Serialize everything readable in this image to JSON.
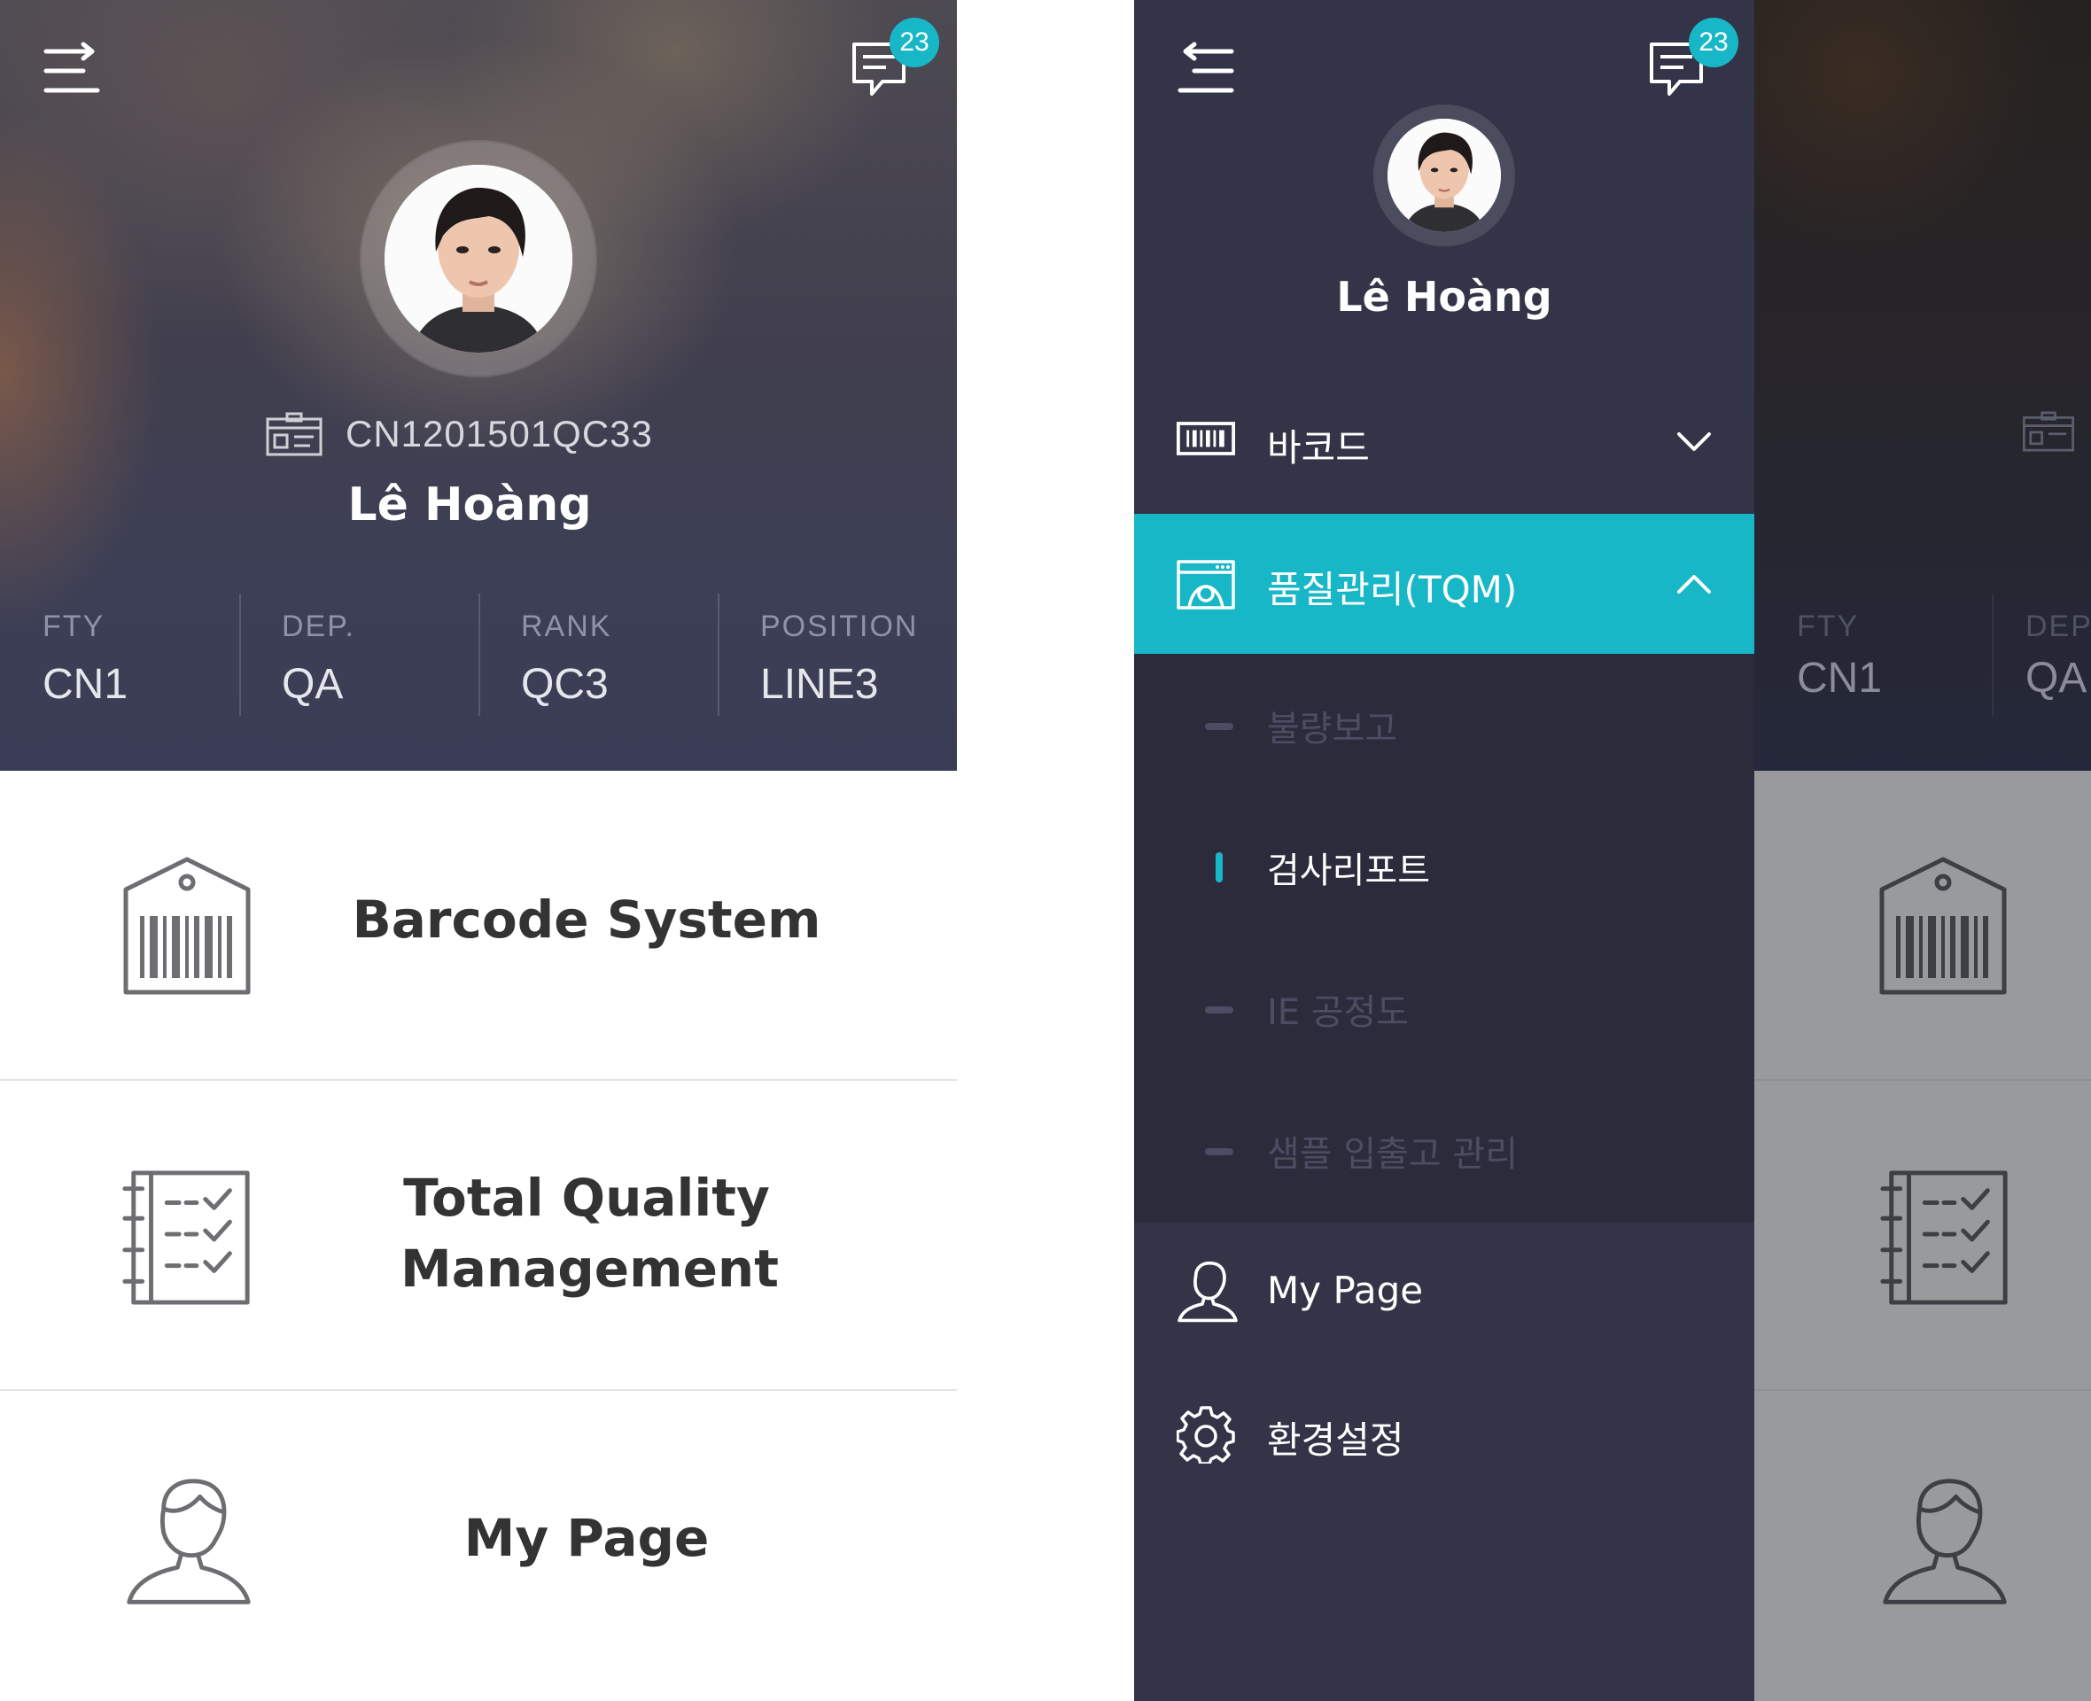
{
  "notifications": {
    "count": "23"
  },
  "profile": {
    "employee_id": "CN1201501QC33",
    "name": "Lê Hoàng"
  },
  "stats": [
    {
      "label": "FTY",
      "value": "CN1"
    },
    {
      "label": "DEP.",
      "value": "QA"
    },
    {
      "label": "RANK",
      "value": "QC3"
    },
    {
      "label": "POSITION",
      "value": "LINE3"
    }
  ],
  "home_menu": [
    {
      "label": "Barcode System",
      "icon": "barcode-tag-icon"
    },
    {
      "label": "Total Quality Management",
      "icon": "checklist-icon"
    },
    {
      "label": "My Page",
      "icon": "user-icon"
    }
  ],
  "drawer": {
    "name": "Lê Hoàng",
    "items": [
      {
        "label": "바코드",
        "icon": "barcode-icon",
        "expanded": false
      },
      {
        "label": "품질관리(TQM)",
        "icon": "quality-window-icon",
        "expanded": true
      },
      {
        "label": "My Page",
        "icon": "user-icon"
      },
      {
        "label": "환경설정",
        "icon": "gear-icon"
      }
    ],
    "tqm_submenu": [
      {
        "label": "불량보고",
        "active": false
      },
      {
        "label": "검사리포트",
        "active": true
      },
      {
        "label": "IE 공정도",
        "active": false
      },
      {
        "label": "샘플 입출고 관리",
        "active": false
      }
    ]
  },
  "colors": {
    "accent": "#18b7c8",
    "drawer_bg": "#343449",
    "submenu_bg": "#2b2b3c",
    "text_dark": "#333333"
  }
}
